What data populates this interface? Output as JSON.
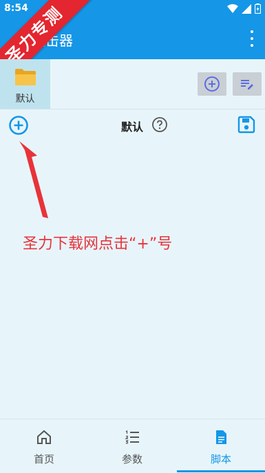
{
  "status": {
    "time": "8:54"
  },
  "appbar": {
    "title": "点击器"
  },
  "ribbon": {
    "text": "圣力专测"
  },
  "folders": [
    {
      "label": "默认",
      "icon": "folder-icon"
    }
  ],
  "toolbar": {
    "add_icon": "add-circle-icon",
    "edit_icon": "edit-list-icon"
  },
  "script_header": {
    "title": "默认",
    "add_icon": "add-circle-icon",
    "help_icon": "help-circle-icon",
    "save_icon": "save-icon"
  },
  "annotation": {
    "text": "圣力下载网点击“+”号"
  },
  "bottom_nav": [
    {
      "label": "首页",
      "icon": "home-icon",
      "active": false
    },
    {
      "label": "参数",
      "icon": "list-icon",
      "active": false
    },
    {
      "label": "脚本",
      "icon": "document-icon",
      "active": true
    }
  ],
  "colors": {
    "primary": "#1596e6",
    "annotation": "#e8333a",
    "ribbon": "#e3262f",
    "background": "#e7f5fb"
  }
}
